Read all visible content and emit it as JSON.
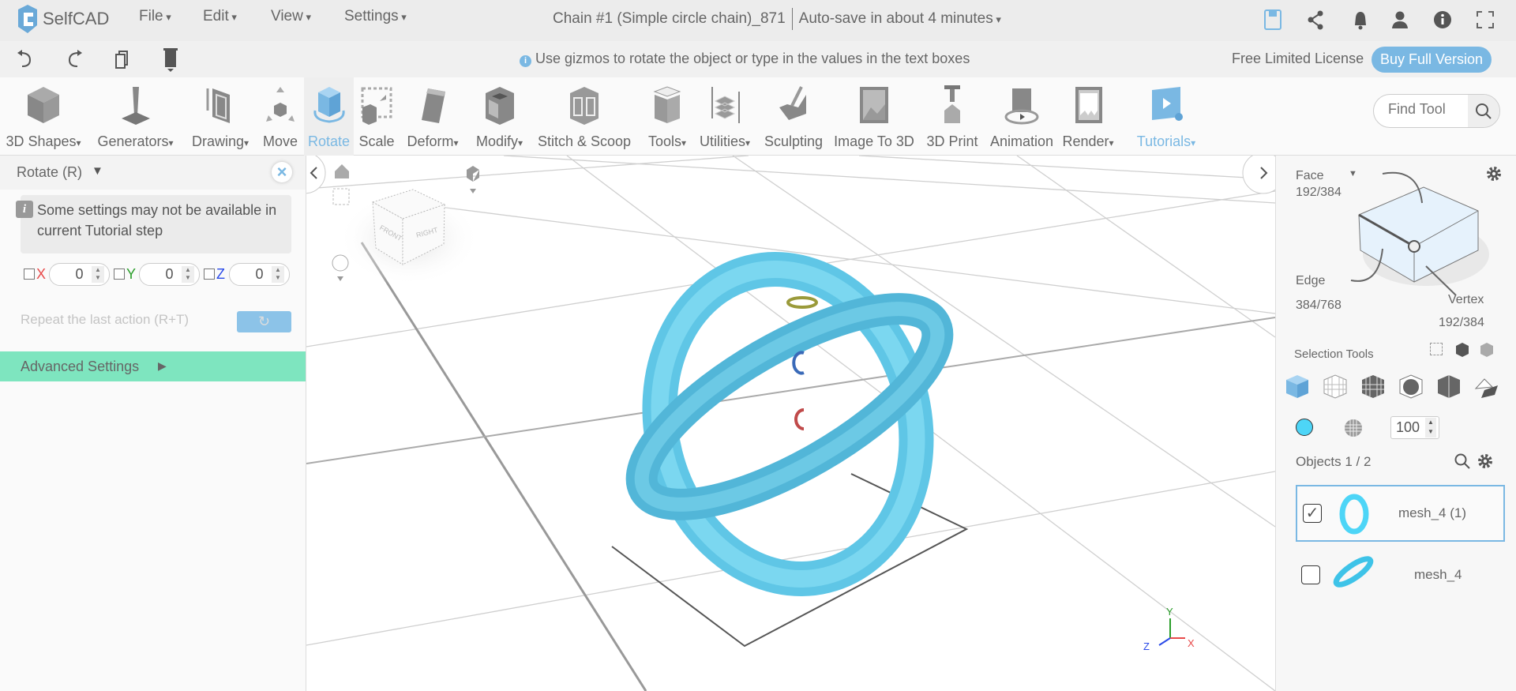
{
  "app": {
    "name": "SelfCAD",
    "menus": [
      "File",
      "Edit",
      "View",
      "Settings"
    ],
    "doc_title": "Chain #1 (Simple circle chain)_871",
    "autosave": "Auto-save in about 4 minutes"
  },
  "top_icons": [
    "save-icon",
    "share-icon",
    "bell-icon",
    "user-icon",
    "info-icon",
    "fullscreen-icon"
  ],
  "bar2": {
    "hint": "Use gizmos to rotate the object or type in the values in the text boxes",
    "license": "Free Limited License",
    "buy": "Buy Full Version"
  },
  "toolbar": {
    "tools": [
      "3D Shapes",
      "Generators",
      "Drawing",
      "Move",
      "Rotate",
      "Scale",
      "Deform",
      "Modify",
      "Stitch & Scoop",
      "Tools",
      "Utilities",
      "Sculpting",
      "Image To 3D",
      "3D Print",
      "Animation",
      "Render",
      "Tutorials"
    ],
    "find_placeholder": "Find Tool"
  },
  "left": {
    "title": "Rotate (R)",
    "notice": "Some settings may not be available in current Tutorial step",
    "axes": {
      "x_label": "X",
      "y_label": "Y",
      "z_label": "Z",
      "x": "0",
      "y": "0",
      "z": "0"
    },
    "repeat": "Repeat the last action (R+T)",
    "advanced": "Advanced Settings"
  },
  "right": {
    "face_label": "Face",
    "face_count": "192/384",
    "edge_label": "Edge",
    "edge_count": "384/768",
    "vertex_label": "Vertex",
    "vertex_count": "192/384",
    "selection_tools": "Selection Tools",
    "opacity": "100",
    "objects_label": "Objects 1 / 2",
    "objects": [
      {
        "name": "mesh_4 (1)",
        "checked": true
      },
      {
        "name": "mesh_4",
        "checked": false
      }
    ]
  },
  "viewport": {
    "axis_x": "X",
    "axis_y": "Y",
    "axis_z": "Z",
    "cube_right": "RIGHT",
    "cube_front": "FRONT"
  },
  "colors": {
    "accent": "#7ab8e3",
    "mesh": "#6fd3ee",
    "advanced_bg": "#7ee5bf",
    "axis_x": "#e84a4a",
    "axis_y": "#2a9d2a",
    "axis_z": "#2a4ae8"
  }
}
